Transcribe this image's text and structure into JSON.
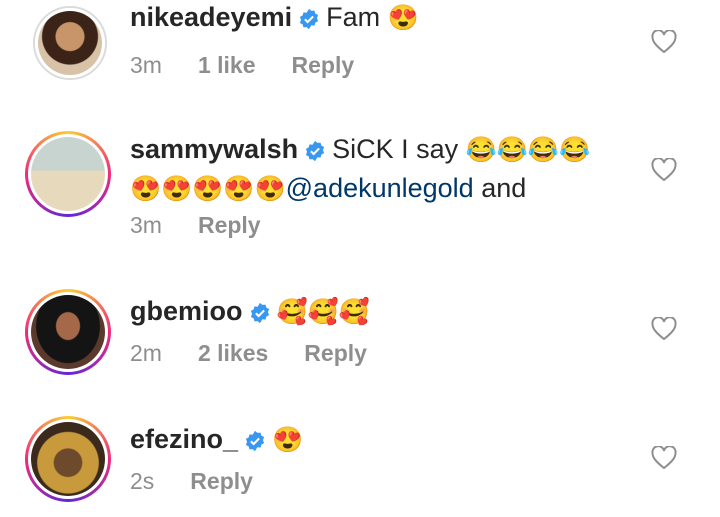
{
  "comments": [
    {
      "username": "nikeadeyemi",
      "text": "Fam",
      "emojis": "😍",
      "time": "3m",
      "likes": "1 like",
      "reply": "Reply"
    },
    {
      "username": "sammywalsh",
      "text": "SiCK I say",
      "emojis": "😂😂😂😂",
      "emojis_line2": "😍😍😍😍😍",
      "mention": "@adekunlegold",
      "text_after": " and",
      "time": "3m",
      "reply": "Reply"
    },
    {
      "username": "gbemioo",
      "emojis": "🥰🥰🥰",
      "time": "2m",
      "likes": "2 likes",
      "reply": "Reply"
    },
    {
      "username": "efezino_",
      "emojis": "😍",
      "time": "2s",
      "reply": "Reply"
    }
  ],
  "colors": {
    "verified": "#3897f0",
    "mention": "#00376b",
    "meta": "#8e8e8e",
    "story_ring": [
      "#f9ce34",
      "#ee2a7b",
      "#6228d7"
    ]
  },
  "icons": {
    "verified": "verified-badge-icon",
    "like": "heart-outline-icon"
  }
}
